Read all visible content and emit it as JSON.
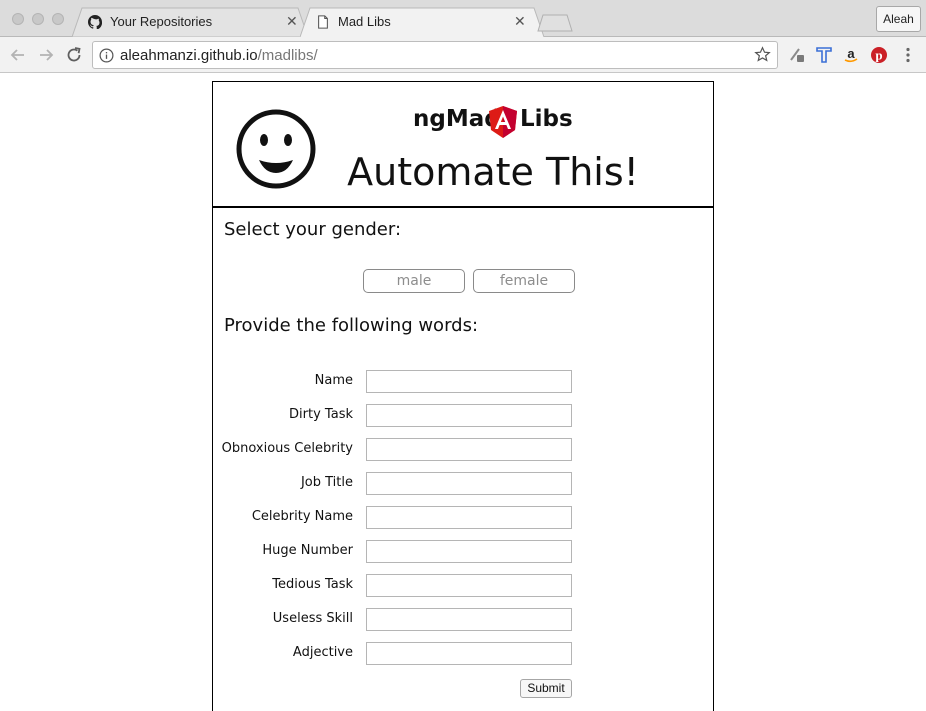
{
  "browser": {
    "tabs": [
      {
        "title": "Your Repositories",
        "icon": "github-icon",
        "active": false
      },
      {
        "title": "Mad Libs",
        "icon": "document-icon",
        "active": true
      }
    ],
    "profile_label": "Aleah",
    "url_host": "aleahmanzi.github.io",
    "url_path": "/madlibs/"
  },
  "page": {
    "brand_left": "ngMad",
    "brand_right": "Libs",
    "headline": "Automate This!",
    "gender_prompt": "Select your gender:",
    "gender_options": [
      "male",
      "female"
    ],
    "words_prompt": "Provide the following words:",
    "fields": [
      {
        "label": "Name",
        "value": ""
      },
      {
        "label": "Dirty Task",
        "value": ""
      },
      {
        "label": "Obnoxious Celebrity",
        "value": ""
      },
      {
        "label": "Job Title",
        "value": ""
      },
      {
        "label": "Celebrity Name",
        "value": ""
      },
      {
        "label": "Huge Number",
        "value": ""
      },
      {
        "label": "Tedious Task",
        "value": ""
      },
      {
        "label": "Useless Skill",
        "value": ""
      },
      {
        "label": "Adjective",
        "value": ""
      }
    ],
    "submit_label": "Submit"
  },
  "colors": {
    "angular_red": "#dd1b16",
    "angular_dark_red": "#c3002f",
    "pinterest": "#cb2027",
    "amazon_orange": "#ff9900",
    "t_icon_blue": "#3b6fd6"
  }
}
